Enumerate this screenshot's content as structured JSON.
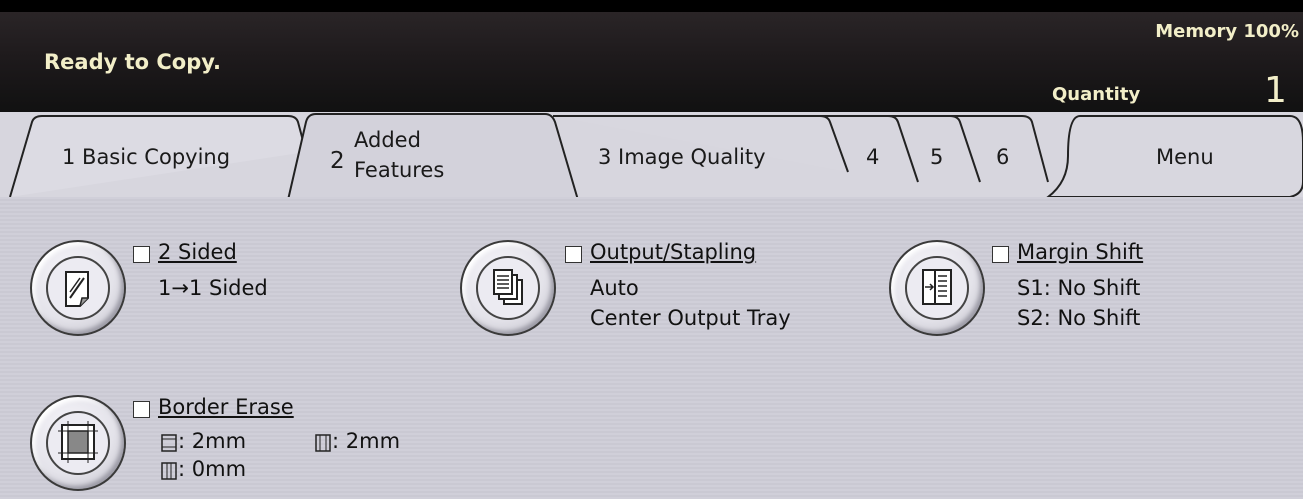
{
  "status": {
    "message": "Ready to Copy.",
    "memory": "Memory 100%",
    "quantity_label": "Quantity",
    "quantity_value": "1"
  },
  "tabs": [
    {
      "label": "1 Basic Copying"
    },
    {
      "number": "2",
      "line1": "Added",
      "line2": "Features"
    },
    {
      "label": "3 Image Quality"
    },
    {
      "label": "4"
    },
    {
      "label": "5"
    },
    {
      "label": "6"
    },
    {
      "label": "Menu"
    }
  ],
  "features": {
    "two_sided": {
      "title": "2 Sided",
      "icon": "page-icon",
      "lines": [
        "1→1 Sided"
      ]
    },
    "output": {
      "title": "Output/Stapling",
      "icon": "pages-stack-icon",
      "lines": [
        "Auto",
        "Center Output Tray"
      ]
    },
    "margin": {
      "title": "Margin Shift",
      "icon": "margin-shift-icon",
      "lines": [
        "S1: No Shift",
        "S2: No Shift"
      ]
    },
    "border": {
      "title": "Border Erase",
      "icon": "border-erase-icon",
      "top_bottom": ": 2mm",
      "left_right": ": 2mm",
      "center": ": 0mm"
    }
  },
  "colors": {
    "status_text": "#f2eec8",
    "status_bg": "#1e1a1c",
    "panel_bg": "#cfcfd8"
  }
}
